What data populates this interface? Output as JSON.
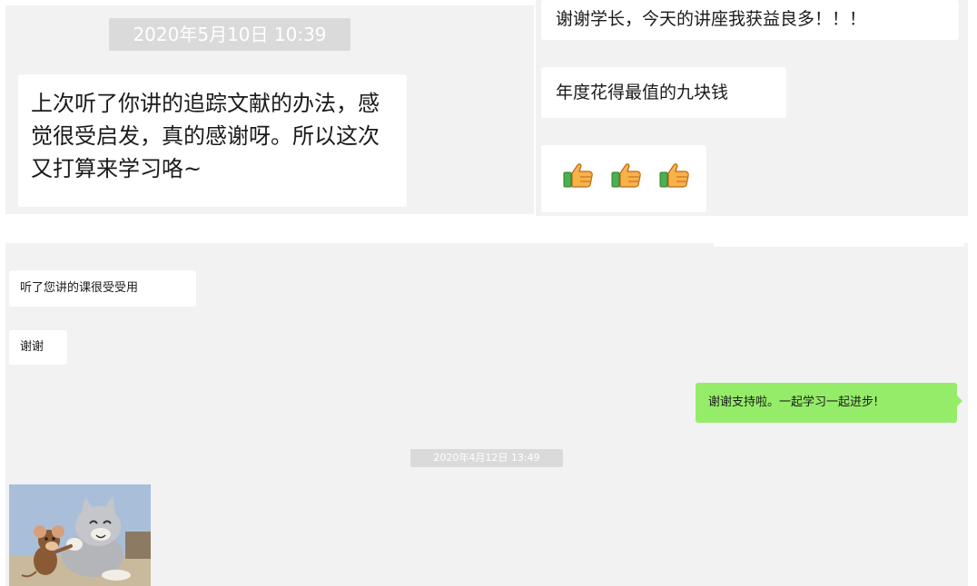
{
  "colors": {
    "panel_bg": "#f2f2f2",
    "bubble_bg": "#ffffff",
    "self_bubble_bg": "#95ec69",
    "timestamp_bg": "#dadada"
  },
  "top_left": {
    "timestamp": "2020年5月10日 10:39",
    "message": "上次听了你讲的追踪文献的办法，感觉很受启发，真的感谢呀。所以这次又打算来学习咯~"
  },
  "top_right": {
    "messages": [
      "谢谢学长，今天的讲座我获益良多！！！",
      "年度花得最值的九块钱"
    ],
    "thumbs_icons": [
      "thumbs-up-icon",
      "thumbs-up-icon",
      "thumbs-up-icon"
    ]
  },
  "bottom": {
    "messages_in": [
      "听了您讲的课很受受用",
      "谢谢"
    ],
    "message_out": "谢谢支持啦。一起学习一起进步!",
    "timestamp": "2020年4月12日 13:49",
    "sticker_icon": "cat-and-mouse-sticker-icon"
  }
}
